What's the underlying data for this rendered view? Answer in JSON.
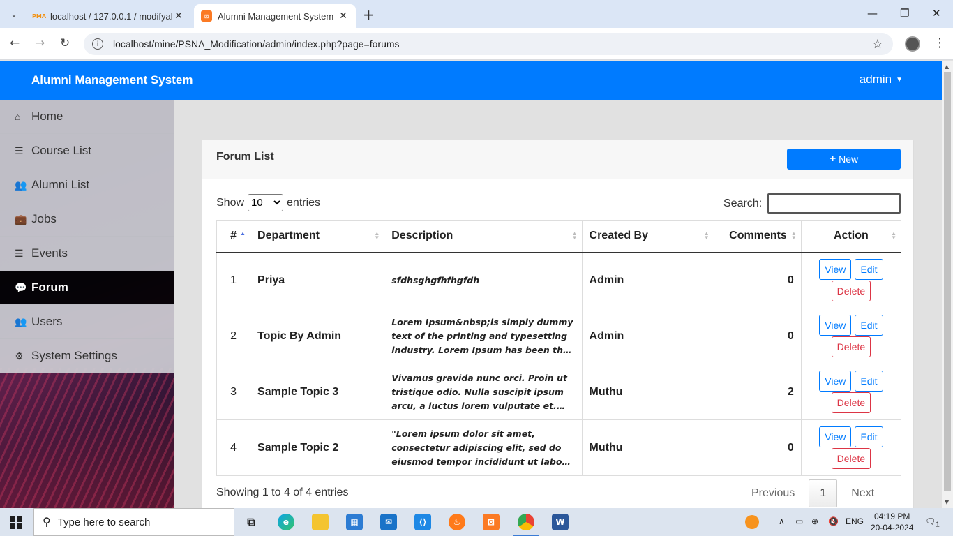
{
  "browser": {
    "tabs": [
      {
        "title": "localhost / 127.0.0.1 / modifyal",
        "favicon": "phpmyadmin-icon",
        "fav_text": "PMA"
      },
      {
        "title": "Alumni Management System",
        "favicon": "xampp-icon"
      }
    ],
    "url": "localhost/mine/PSNA_Modification/admin/index.php?page=forums"
  },
  "app": {
    "brand": "Alumni Management System",
    "user": "admin"
  },
  "sidebar": {
    "items": [
      {
        "label": "Home",
        "icon": "home-icon",
        "glyph": "⌂"
      },
      {
        "label": "Course List",
        "icon": "list-icon",
        "glyph": "☰"
      },
      {
        "label": "Alumni List",
        "icon": "users-icon",
        "glyph": "👥"
      },
      {
        "label": "Jobs",
        "icon": "briefcase-icon",
        "glyph": "💼"
      },
      {
        "label": "Events",
        "icon": "list-icon",
        "glyph": "☰"
      },
      {
        "label": "Forum",
        "icon": "comments-icon",
        "glyph": "💬",
        "active": true
      },
      {
        "label": "Users",
        "icon": "users-icon",
        "glyph": "👥"
      },
      {
        "label": "System Settings",
        "icon": "gears-icon",
        "glyph": "⚙"
      }
    ]
  },
  "forum": {
    "title": "Forum List",
    "new_label": "New",
    "show_label": "Show",
    "entries_value": "10",
    "entries_label": "entries",
    "search_label": "Search:",
    "columns": [
      "#",
      "Department",
      "Description",
      "Created By",
      "Comments",
      "Action"
    ],
    "rows": [
      {
        "num": "1",
        "department": "Priya",
        "description": "sfdhsghgfhfhgfdh",
        "created_by": "Admin",
        "comments": "0"
      },
      {
        "num": "2",
        "department": "Topic By Admin",
        "description": "Lorem Ipsum&nbsp;is simply dummy text of the printing and typesetting industry. Lorem Ipsum has been the industry's…",
        "created_by": "Admin",
        "comments": "0"
      },
      {
        "num": "3",
        "department": "Sample Topic 3",
        "description": "Vivamus gravida nunc orci. Proin ut tristique odio. Nulla suscipit ipsum arcu, a luctus lorem vulputate et. Maecenas…",
        "created_by": "Muthu",
        "comments": "2"
      },
      {
        "num": "4",
        "department": "Sample Topic 2",
        "description": "\"Lorem ipsum dolor sit amet, consectetur adipiscing elit, sed do eiusmod tempor incididunt ut labore et…",
        "created_by": "Muthu",
        "comments": "0"
      }
    ],
    "action_labels": {
      "view": "View",
      "edit": "Edit",
      "delete": "Delete"
    },
    "info": "Showing 1 to 4 of 4 entries",
    "pager": {
      "previous": "Previous",
      "page": "1",
      "next": "Next"
    }
  },
  "taskbar": {
    "search_placeholder": "Type here to search",
    "lang": "ENG",
    "time": "04:19 PM",
    "date": "20-04-2024",
    "notifications": "1"
  },
  "colors": {
    "primary": "#007bff",
    "danger": "#dc3545",
    "active_nav": "#000000"
  }
}
